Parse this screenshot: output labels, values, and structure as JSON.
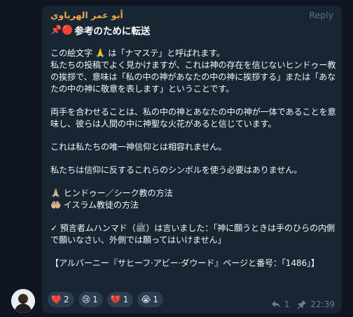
{
  "message": {
    "sender": "أبو عمر الهرباوي",
    "reply_label": "Reply",
    "title_icons": "📌🔴",
    "title": "参考のために転送",
    "paragraphs": [
      [
        "この絵文字 🙏 は「ナマステ」と呼ばれます。",
        "私たちの投稿でよく見かけますが、これは神の存在を信じないヒンドゥー教の挨拶で、意味は「私の中の神があなたの中の神に挨拶する」または「あなたの中の神に敬意を表します」ということです。"
      ],
      [
        "両手を合わせることは、私の中の神とあなたの中の神が一体であることを意味し、彼らは人間の中に神聖な火花があると信じています。"
      ],
      [
        "これは私たちの唯一神信仰とは相容れません。"
      ],
      [
        "私たちは信仰に反するこれらのシンボルを使う必要はありません。"
      ],
      [
        "🙏🏼 ヒンドゥー／シーク教の方法",
        "🤲🏼 イスラム教徒の方法"
      ],
      [
        "✓ 預言者ムハンマド（ﷺ）は言いました：「神に願うときは手のひらの内側で願いなさい、外側では願ってはいけません」"
      ],
      [
        "【アルバーニー『サヒーフ·アビー·ダウード』ページと番号：「1486」】"
      ]
    ],
    "reactions": [
      {
        "emoji": "❤️",
        "count": "2"
      },
      {
        "emoji": "😢",
        "count": "1"
      },
      {
        "emoji": "💔",
        "count": "1"
      },
      {
        "emoji": "😭",
        "count": "1"
      }
    ],
    "replies_count": "1",
    "time": "22:39"
  }
}
